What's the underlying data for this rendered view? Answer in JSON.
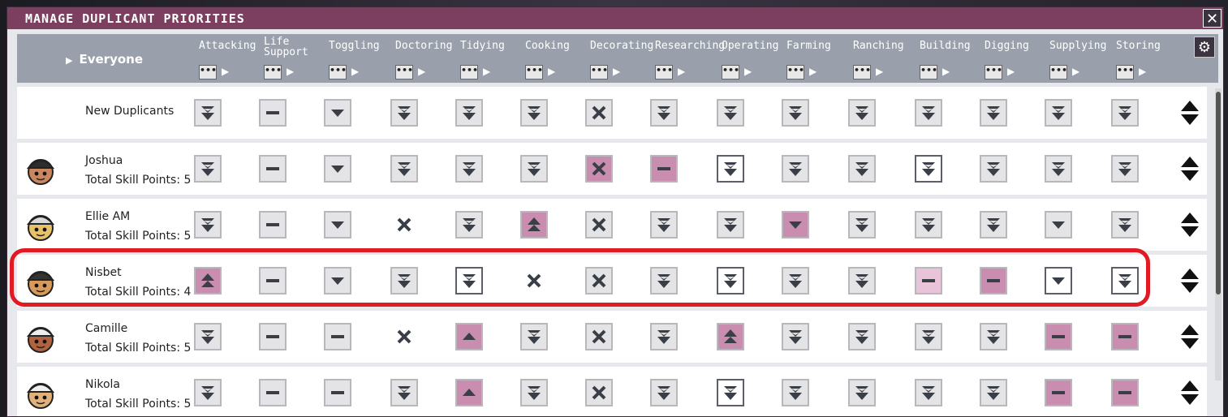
{
  "window": {
    "title": "MANAGE DUPLICANT PRIORITIES",
    "close_label": "✕",
    "settings_icon": "gear-icon"
  },
  "header": {
    "everyone_label": "Everyone",
    "control_label": "•••",
    "columns": [
      "Attacking",
      "Life Support",
      "Toggling",
      "Doctoring",
      "Tidying",
      "Cooking",
      "Decorating",
      "Researching",
      "Operating",
      "Farming",
      "Ranching",
      "Building",
      "Digging",
      "Supplying",
      "Storing"
    ]
  },
  "colors": {
    "accent": "#7c3f5f",
    "highlight_pink": "#c98eaf",
    "light_pink": "#efd9e5",
    "highlight_ring": "#e01b24",
    "header_gray": "#9aa0ab"
  },
  "priority_legend": {
    "vh": "very high (double up)",
    "h": "high (up)",
    "n": "standard (dash)",
    "l": "low (down)",
    "vl": "very low (double down)",
    "x": "disabled"
  },
  "rows": [
    {
      "name": "New Duplicants",
      "skill_points": "",
      "avatar": "",
      "cells": [
        [
          "vl",
          "g"
        ],
        [
          "n",
          "g"
        ],
        [
          "l",
          "g"
        ],
        [
          "vl",
          "g"
        ],
        [
          "vl",
          "g"
        ],
        [
          "vl",
          "g"
        ],
        [
          "x",
          "g"
        ],
        [
          "vl",
          "g"
        ],
        [
          "vl",
          "g"
        ],
        [
          "vl",
          "g"
        ],
        [
          "vl",
          "g"
        ],
        [
          "vl",
          "g"
        ],
        [
          "vl",
          "g"
        ],
        [
          "vl",
          "g"
        ],
        [
          "vl",
          "g"
        ]
      ]
    },
    {
      "name": "Joshua",
      "skill_points": "Total Skill Points: 5",
      "avatar": "joshua-avatar",
      "cells": [
        [
          "vl",
          "g"
        ],
        [
          "n",
          "g"
        ],
        [
          "l",
          "g"
        ],
        [
          "vl",
          "g"
        ],
        [
          "vl",
          "g"
        ],
        [
          "vl",
          "g"
        ],
        [
          "x",
          "p"
        ],
        [
          "n",
          "p"
        ],
        [
          "vl",
          "w"
        ],
        [
          "vl",
          "g"
        ],
        [
          "vl",
          "g"
        ],
        [
          "vl",
          "w"
        ],
        [
          "vl",
          "g"
        ],
        [
          "vl",
          "g"
        ],
        [
          "vl",
          "g"
        ]
      ]
    },
    {
      "name": "Ellie AM",
      "skill_points": "Total Skill Points: 5",
      "avatar": "ellie-avatar",
      "cells": [
        [
          "vl",
          "g"
        ],
        [
          "n",
          "g"
        ],
        [
          "l",
          "g"
        ],
        [
          "x",
          "none"
        ],
        [
          "vl",
          "g"
        ],
        [
          "vh",
          "p"
        ],
        [
          "x",
          "g"
        ],
        [
          "vl",
          "g"
        ],
        [
          "vl",
          "g"
        ],
        [
          "l",
          "p"
        ],
        [
          "vl",
          "g"
        ],
        [
          "vl",
          "g"
        ],
        [
          "vl",
          "g"
        ],
        [
          "l",
          "g"
        ],
        [
          "vl",
          "g"
        ]
      ]
    },
    {
      "name": "Nisbet",
      "skill_points": "Total Skill Points: 4",
      "avatar": "nisbet-avatar",
      "cells": [
        [
          "vh",
          "p"
        ],
        [
          "n",
          "g"
        ],
        [
          "l",
          "g"
        ],
        [
          "vl",
          "g"
        ],
        [
          "vl",
          "w"
        ],
        [
          "x",
          "none"
        ],
        [
          "x",
          "g"
        ],
        [
          "vl",
          "g"
        ],
        [
          "vl",
          "w"
        ],
        [
          "vl",
          "g"
        ],
        [
          "vl",
          "g"
        ],
        [
          "n",
          "lp"
        ],
        [
          "n",
          "p"
        ],
        [
          "l",
          "w"
        ],
        [
          "vl",
          "w"
        ]
      ]
    },
    {
      "name": "Camille",
      "skill_points": "Total Skill Points: 5",
      "avatar": "camille-avatar",
      "cells": [
        [
          "vl",
          "g"
        ],
        [
          "n",
          "g"
        ],
        [
          "n",
          "g"
        ],
        [
          "x",
          "none"
        ],
        [
          "h",
          "p"
        ],
        [
          "vl",
          "g"
        ],
        [
          "x",
          "g"
        ],
        [
          "vl",
          "g"
        ],
        [
          "vh",
          "p"
        ],
        [
          "vl",
          "g"
        ],
        [
          "vl",
          "g"
        ],
        [
          "vl",
          "g"
        ],
        [
          "vl",
          "g"
        ],
        [
          "n",
          "p"
        ],
        [
          "n",
          "p"
        ]
      ]
    },
    {
      "name": "Nikola",
      "skill_points": "Total Skill Points: 5",
      "avatar": "nikola-avatar",
      "cells": [
        [
          "vl",
          "g"
        ],
        [
          "n",
          "g"
        ],
        [
          "n",
          "g"
        ],
        [
          "vl",
          "g"
        ],
        [
          "h",
          "p"
        ],
        [
          "vl",
          "g"
        ],
        [
          "x",
          "g"
        ],
        [
          "vl",
          "g"
        ],
        [
          "vl",
          "w"
        ],
        [
          "vl",
          "g"
        ],
        [
          "vl",
          "g"
        ],
        [
          "vl",
          "g"
        ],
        [
          "vl",
          "g"
        ],
        [
          "n",
          "p"
        ],
        [
          "n",
          "p"
        ]
      ]
    }
  ]
}
